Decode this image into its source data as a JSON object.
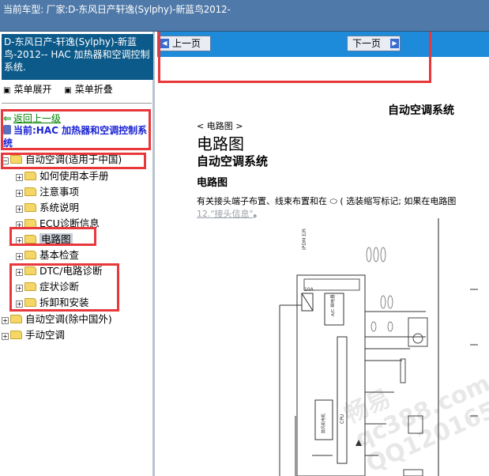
{
  "top_bar": {
    "title": "当前车型:   厂家:D-东风日产轩逸(Sylphy)-新蓝鸟2012-"
  },
  "sidebar": {
    "header": "D-东风日产-轩逸(Sylphy)-新蓝鸟-2012-- HAC 加热器和空调控制系统.",
    "menu_expand": "菜单展开",
    "menu_collapse": "菜单折叠",
    "back_link": "返回上一级",
    "current": "当前:HAC 加热器和空调控制系统",
    "tree": [
      {
        "label": "自动空调(适用于中国)",
        "expanded": true
      },
      {
        "label": "如何使用本手册"
      },
      {
        "label": "注意事项"
      },
      {
        "label": "系统说明"
      },
      {
        "label": "ECU诊断信息"
      },
      {
        "label": "电路图",
        "selected": true
      },
      {
        "label": "基本检查"
      },
      {
        "label": "DTC/电路诊断"
      },
      {
        "label": "症状诊断"
      },
      {
        "label": "拆卸和安装"
      },
      {
        "label": "自动空调(除中国外)"
      },
      {
        "label": "手动空调"
      }
    ]
  },
  "nav": {
    "prev": "上一页",
    "next": "下一页"
  },
  "document": {
    "system_title": "自动空调系统",
    "breadcrumb": "< 电路图 >",
    "heading1": "电路图",
    "heading2": "自动空调系统",
    "heading3": "电路图",
    "paragraph": "有关接头端子布置、线束布置和在",
    "paragraph_tail": "( 选装缩写标记; 如果在电路图",
    "link_text": "12.\"接头信息\"",
    "link_suffix": "。"
  },
  "diagram_labels": {
    "ipdm": "IPDM E/R",
    "relay": "A/C 继电器",
    "fuse": "10A",
    "cpu": "CPU",
    "blower": "鼓风机电机"
  },
  "watermark": {
    "line1": "畅易",
    "line2": "qc388.com",
    "line3": "QQ120165"
  },
  "colors": {
    "accent_red": "#e8383c",
    "nav_blue": "#1d8bd9",
    "header_blue": "#0c5a8a"
  }
}
